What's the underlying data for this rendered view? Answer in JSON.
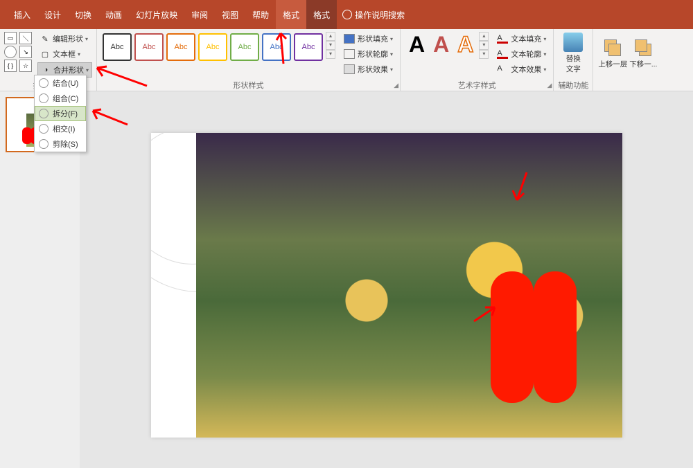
{
  "tabs": {
    "insert": "插入",
    "design": "设计",
    "transition": "切换",
    "animation": "动画",
    "slideshow": "幻灯片放映",
    "review": "审阅",
    "view": "视图",
    "help": "帮助",
    "format1": "格式",
    "format2": "格式",
    "search": "操作说明搜索"
  },
  "groups": {
    "insert_shapes": "插入形状",
    "shape_styles": "形状样式",
    "wordart_styles": "艺术字样式",
    "accessibility": "辅助功能"
  },
  "tools": {
    "edit_shape": "编辑形状",
    "text_box": "文本框",
    "merge_shapes": "合并形状"
  },
  "merge_menu": {
    "union": "结合(U)",
    "combine": "组合(C)",
    "fragment": "拆分(F)",
    "intersect": "相交(I)",
    "subtract": "剪除(S)"
  },
  "style_gallery_label": "Abc",
  "shape_effects": {
    "fill": "形状填充",
    "outline": "形状轮廓",
    "effects": "形状效果"
  },
  "text_effects": {
    "fill": "文本填充",
    "outline": "文本轮廓",
    "effects": "文本效果"
  },
  "alt_text": {
    "line1": "替换",
    "line2": "文字"
  },
  "arrange": {
    "bring_forward": "上移一层",
    "send_backward": "下移一..."
  },
  "style_colors": [
    "#333333",
    "#c0504d",
    "#e46c0a",
    "#ffc000",
    "#70ad47",
    "#4472c4",
    "#7030a0"
  ],
  "wordart_colors": [
    "#000000",
    "#c0504d",
    "#e46c0a"
  ]
}
